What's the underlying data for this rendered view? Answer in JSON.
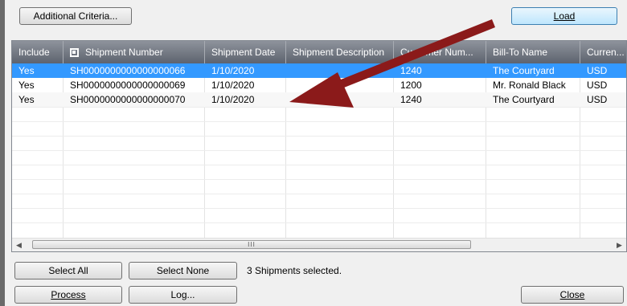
{
  "top": {
    "additional_criteria": "Additional Criteria...",
    "load": "Load"
  },
  "grid": {
    "columns": [
      "Include",
      "Shipment Number",
      "Shipment Date",
      "Shipment Description",
      "Customer Num...",
      "Bill-To Name",
      "Curren..."
    ],
    "rows": [
      [
        "Yes",
        "SH0000000000000000066",
        "1/10/2020",
        "",
        "1240",
        "The Courtyard",
        "USD"
      ],
      [
        "Yes",
        "SH0000000000000000069",
        "1/10/2020",
        "",
        "1200",
        "Mr. Ronald Black",
        "USD"
      ],
      [
        "Yes",
        "SH0000000000000000070",
        "1/10/2020",
        "",
        "1240",
        "The Courtyard",
        "USD"
      ]
    ],
    "selected_row": 0,
    "scroll_grip": "III"
  },
  "bottom": {
    "select_all": "Select All",
    "select_none": "Select None",
    "status": "3 Shipments selected.",
    "process": "Process",
    "log": "Log...",
    "close": "Close"
  },
  "colors": {
    "selection": "#3399ff",
    "header": "#6f747d",
    "annotation_arrow": "#8b1a1a"
  }
}
